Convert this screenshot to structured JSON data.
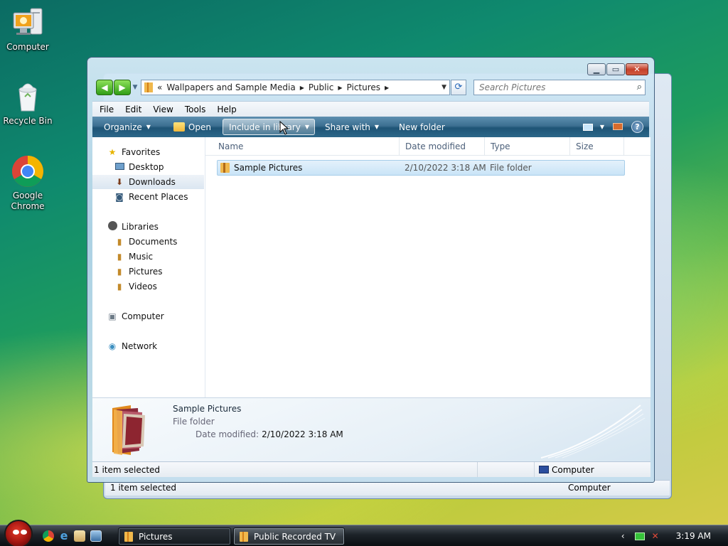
{
  "desktop": {
    "icons": [
      {
        "label": "Computer"
      },
      {
        "label": "Recycle Bin"
      },
      {
        "label": "Google Chrome"
      }
    ]
  },
  "window": {
    "address": {
      "overflow": "«",
      "crumbs": [
        "Wallpapers and Sample Media",
        "Public",
        "Pictures"
      ]
    },
    "search_placeholder": "Search Pictures",
    "menu": [
      "File",
      "Edit",
      "View",
      "Tools",
      "Help"
    ],
    "toolbar": {
      "organize": "Organize",
      "open": "Open",
      "include": "Include in library",
      "share": "Share with",
      "new_folder": "New folder"
    },
    "nav": {
      "favorites": "Favorites",
      "desktop": "Desktop",
      "downloads": "Downloads",
      "recent": "Recent Places",
      "libraries": "Libraries",
      "documents": "Documents",
      "music": "Music",
      "pictures": "Pictures",
      "videos": "Videos",
      "computer": "Computer",
      "network": "Network"
    },
    "columns": [
      "Name",
      "Date modified",
      "Type",
      "Size"
    ],
    "files": [
      {
        "name": "Sample Pictures",
        "date": "2/10/2022 3:18 AM",
        "type": "File folder",
        "size": ""
      }
    ],
    "details": {
      "name": "Sample Pictures",
      "type": "File folder",
      "modified_label": "Date modified:",
      "modified_value": "2/10/2022 3:18 AM"
    },
    "status": {
      "selected": "1 item selected",
      "location": "Computer"
    }
  },
  "back_window": {
    "status": {
      "selected": "1 item selected",
      "location": "Computer"
    }
  },
  "taskbar": {
    "buttons": [
      {
        "label": "Pictures",
        "active": true
      },
      {
        "label": "Public Recorded TV",
        "active": false
      }
    ],
    "clock": "3:19 AM"
  },
  "colors": {
    "toolbar": "#2c6789",
    "selection": "#c9e4f7",
    "nav_green": "#2f9d16"
  }
}
